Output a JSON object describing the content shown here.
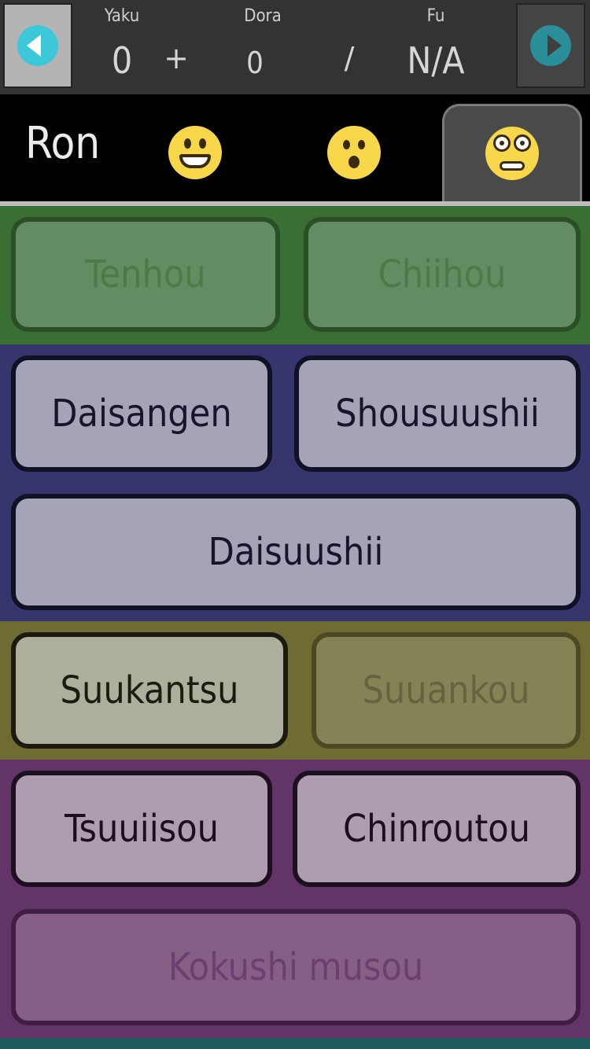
{
  "header": {
    "yaku_label": "Yaku",
    "dora_label": "Dora",
    "fu_label": "Fu",
    "yaku_value": "0",
    "plus": "+",
    "dora_value": "0",
    "slash": "/",
    "fu_value": "N/A",
    "prev_icon": "chevron-left-icon",
    "next_icon": "chevron-right-icon"
  },
  "tabs": {
    "ron_label": "Ron",
    "items": [
      {
        "icon": "grinning-face-icon"
      },
      {
        "icon": "surprised-face-icon"
      },
      {
        "icon": "flushed-face-icon",
        "active": true
      }
    ]
  },
  "yakuman": {
    "tenhou": {
      "label": "Tenhou",
      "enabled": false
    },
    "chiihou": {
      "label": "Chiihou",
      "enabled": false
    },
    "daisangen": {
      "label": "Daisangen",
      "enabled": true
    },
    "shousuushii": {
      "label": "Shousuushii",
      "enabled": true
    },
    "daisuushii": {
      "label": "Daisuushii",
      "enabled": true
    },
    "suukantsu": {
      "label": "Suukantsu",
      "enabled": true
    },
    "suuankou": {
      "label": "Suuankou",
      "enabled": false
    },
    "tsuuiisou": {
      "label": "Tsuuiisou",
      "enabled": true
    },
    "chinroutou": {
      "label": "Chinroutou",
      "enabled": true
    },
    "kokushi": {
      "label": "Kokushi musou",
      "enabled": false
    }
  },
  "colors": {
    "green_section": "#3a6f33",
    "blue_section": "#36356d",
    "olive_section": "#6e6b33",
    "purple_section": "#623468",
    "accent": "#3cc8d8"
  }
}
